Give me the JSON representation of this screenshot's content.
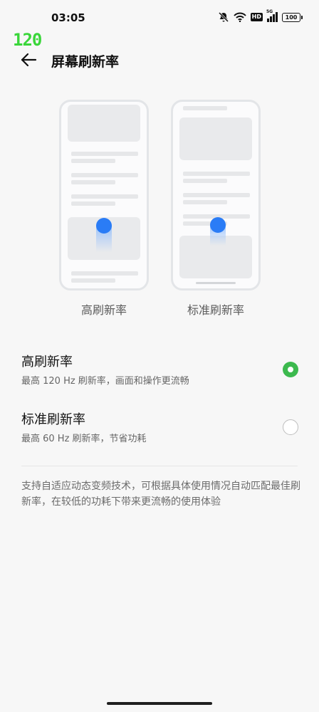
{
  "status_bar": {
    "time": "03:05",
    "hd_badge": "HD",
    "signal_label": "5G",
    "battery": "100",
    "icons": [
      "mute-icon",
      "wifi-icon",
      "hd-icon",
      "signal-icon",
      "battery-icon"
    ]
  },
  "fps_overlay": "120",
  "header": {
    "title": "屏幕刷新率",
    "back_icon": "arrow-left-icon"
  },
  "previews": [
    {
      "label": "高刷新率"
    },
    {
      "label": "标准刷新率"
    }
  ],
  "options": [
    {
      "title": "高刷新率",
      "subtitle": "最高 120 Hz 刷新率，画面和操作更流畅",
      "selected": true
    },
    {
      "title": "标准刷新率",
      "subtitle": "最高 60 Hz 刷新率，节省功耗",
      "selected": false
    }
  ],
  "description": "支持自适应动态变频技术，可根据具体使用情况自动匹配最佳刷新率，在较低的功耗下带来更流畅的使用体验",
  "colors": {
    "accent_green": "#3cb94e",
    "accent_blue": "#2a7cf6",
    "fps_green": "#3ad63a",
    "background": "#f7f7f7"
  }
}
